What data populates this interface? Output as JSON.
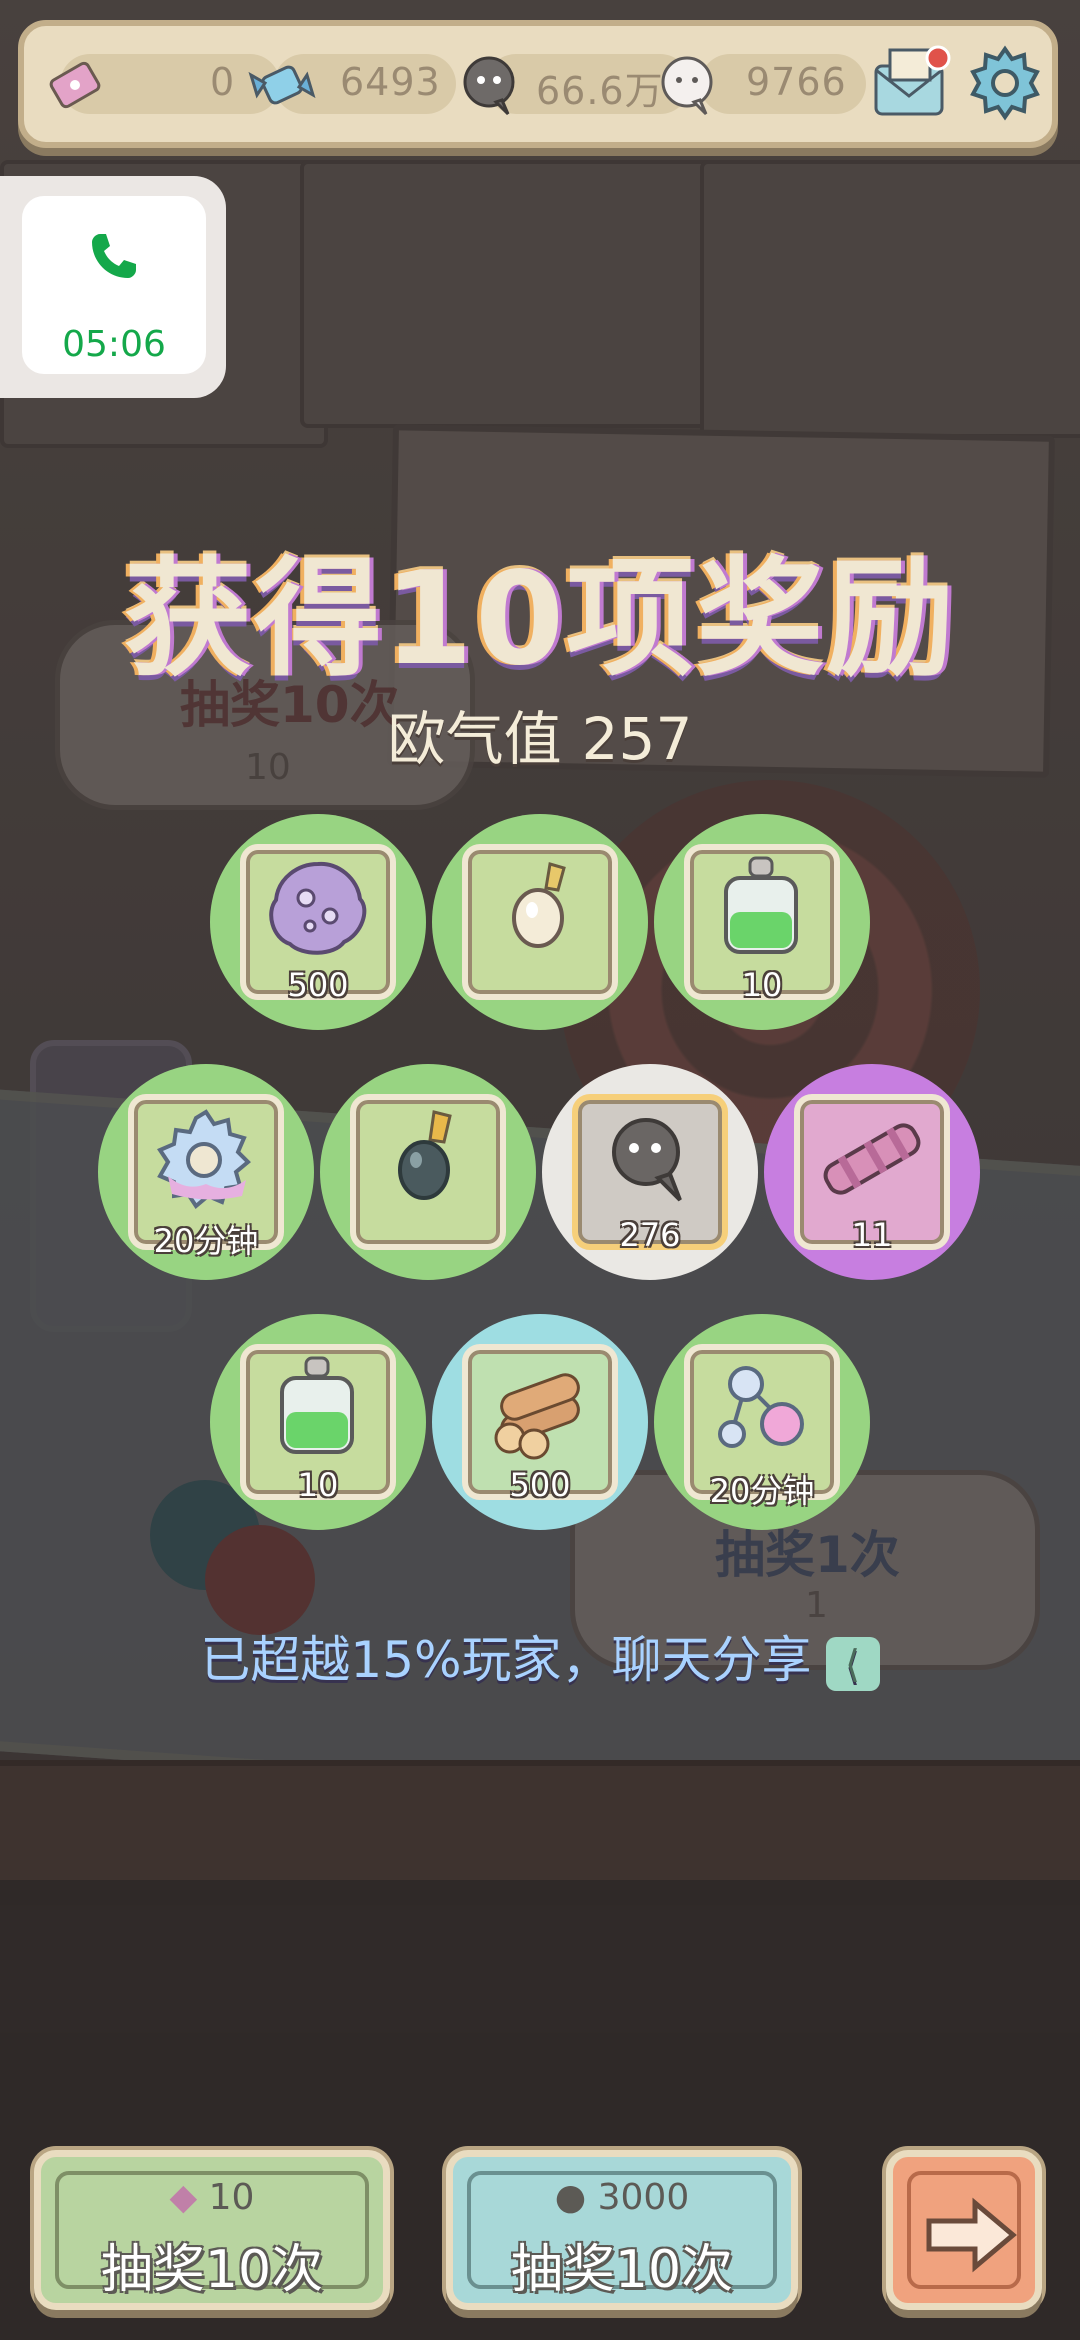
{
  "topbar": {
    "tickets": "0",
    "candies": "6493",
    "dark_bubbles": "66.6万",
    "light_bubbles": "9766"
  },
  "call": {
    "time": "05:06"
  },
  "reward": {
    "title": "获得10项奖励",
    "luck_label": "欧气值",
    "luck_value": "257",
    "items": [
      {
        "name": "virus",
        "qty": "500",
        "bg": "green"
      },
      {
        "name": "pearl-pendant",
        "qty": "",
        "bg": "green"
      },
      {
        "name": "green-potion",
        "qty": "10",
        "bg": "green"
      },
      {
        "name": "gear",
        "qty": "20分钟",
        "bg": "green"
      },
      {
        "name": "dark-pendant",
        "qty": "",
        "bg": "green"
      },
      {
        "name": "speech-bubble",
        "qty": "276",
        "bg": "white"
      },
      {
        "name": "telescope",
        "qty": "11",
        "bg": "purple"
      },
      {
        "name": "green-potion",
        "qty": "10",
        "bg": "green"
      },
      {
        "name": "wood-logs",
        "qty": "500",
        "bg": "cyan"
      },
      {
        "name": "molecule",
        "qty": "20分钟",
        "bg": "green"
      }
    ],
    "share_text": "已超越15%玩家，聊天分享"
  },
  "background_plates": {
    "left_title": "抽奖10次",
    "left_cost": "10",
    "right_title": "抽奖1次",
    "right_cost": "1"
  },
  "buttons": {
    "ticket_draw": {
      "cost": "10",
      "label": "抽奖10次"
    },
    "bubble_draw": {
      "cost": "3000",
      "label": "抽奖10次"
    }
  },
  "colors": {
    "item_green": "#98d482",
    "item_purple": "#c77ee0",
    "item_cyan": "#9edde2",
    "share_text": "#a9d2ff"
  }
}
